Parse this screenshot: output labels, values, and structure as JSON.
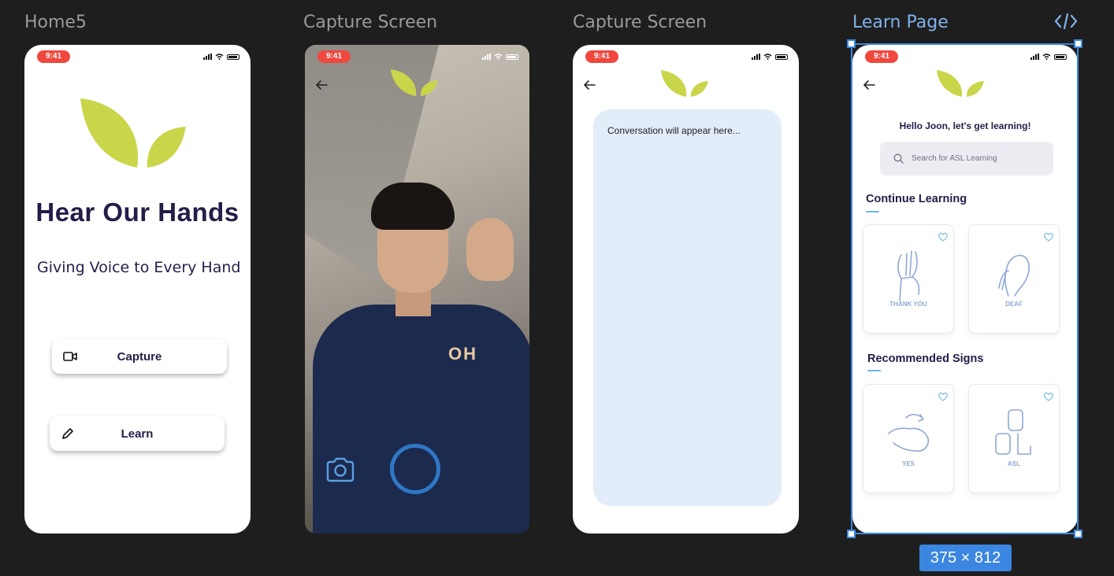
{
  "frames": {
    "home": {
      "label": "Home5",
      "time": "9:41",
      "title": "Hear Our Hands",
      "subtitle": "Giving Voice to Every Hand",
      "capture_label": "Capture",
      "learn_label": "Learn"
    },
    "capture_camera": {
      "label": "Capture Screen",
      "time": "9:41",
      "shirt_text": "OH"
    },
    "capture_convo": {
      "label": "Capture Screen",
      "time": "9:41",
      "placeholder": "Conversation will appear here..."
    },
    "learn": {
      "label": "Learn Page",
      "time": "9:41",
      "greeting": "Hello Joon, let's get learning!",
      "search_placeholder": "Search for ASL Learning",
      "continue_title": "Continue Learning",
      "recommended_title": "Recommended Signs",
      "continue_cards": [
        {
          "caption": "THANK YOU"
        },
        {
          "caption": "DEAF"
        }
      ],
      "recommended_cards": [
        {
          "caption": "YES"
        },
        {
          "caption": "ASL"
        }
      ]
    }
  },
  "selection_dimensions": "375 × 812",
  "colors": {
    "background": "#1e1e1e",
    "brand_navy": "#231d48",
    "leaf_green": "#c9d64a",
    "time_pill": "#f0483e",
    "selection_blue": "#3a86e0",
    "convo_box": "#e3ecf9"
  }
}
